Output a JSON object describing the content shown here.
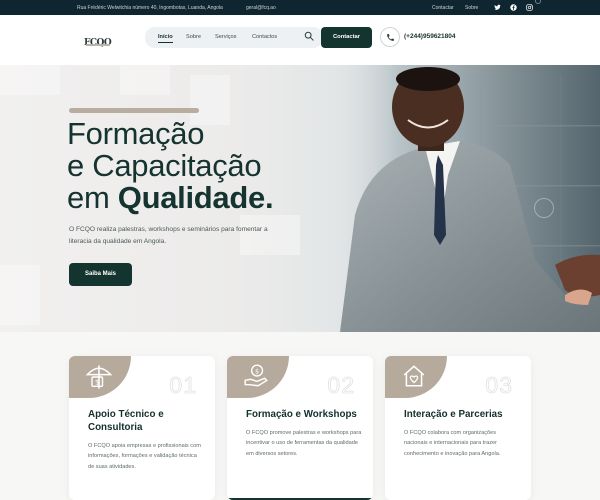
{
  "topbar": {
    "address": "Rua Frédéric Welwitchia número 40, Ingombotas, Luanda, Angola",
    "email": "geral@fcq.ao",
    "links": [
      "Contactar",
      "Sobre"
    ],
    "social_icons": [
      "twitter-icon",
      "facebook-icon",
      "instagram-icon"
    ]
  },
  "header": {
    "logo_text": "FCQO",
    "nav": [
      "Início",
      "Sobre",
      "Serviços",
      "Contactos"
    ],
    "active_nav": "Início",
    "search_icon": "search-icon",
    "contact_button": "Contactar",
    "phone_icon": "phone-icon",
    "phone": "(+244)959621804"
  },
  "hero": {
    "title_line1": "Formação",
    "title_line2": "e Capacitação",
    "title_line3_prefix": "em ",
    "title_line3_bold": "Qualidade.",
    "description": "O FCQO realiza palestras, workshops e seminários para fomentar a literacia da qualidade em Angola.",
    "cta": "Saiba Mais"
  },
  "features": [
    {
      "icon": "umbrella-money-icon",
      "number": "01",
      "title": "Apoio Técnico e Consultoria",
      "text": "O FCQO apoia empresas e profissionais com informações, formações e validação técnica de suas atividades."
    },
    {
      "icon": "hand-money-icon",
      "number": "02",
      "title": "Formação e Workshops",
      "text": "O FCQO promove palestras e workshops para incentivar o uso de ferramentas da qualidade em diversos setores."
    },
    {
      "icon": "house-icon",
      "number": "03",
      "title": "Interação e Parcerias",
      "text": "O FCQO colabora com organizações nacionais e internacionais para trazer conhecimento e inovação para Angola."
    }
  ],
  "colors": {
    "primary": "#14352f",
    "accent": "#b6aa9d",
    "topbar": "#0f2630"
  }
}
